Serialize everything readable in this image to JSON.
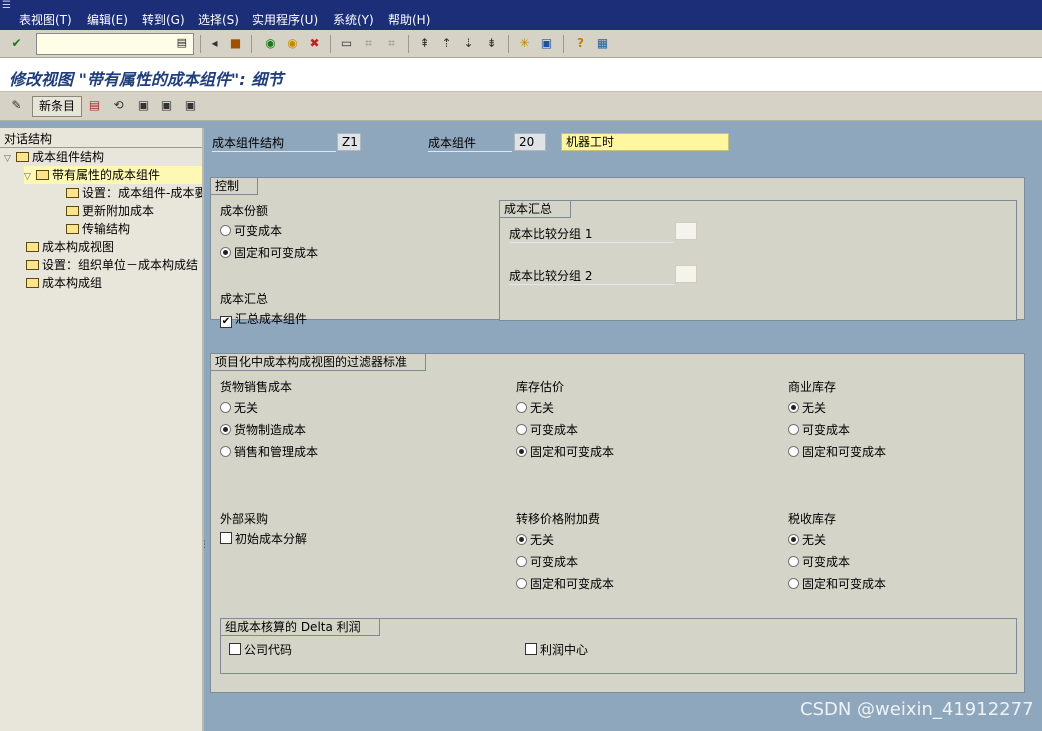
{
  "menu": [
    "表视图(T)",
    "编辑(E)",
    "转到(G)",
    "选择(S)",
    "实用程序(U)",
    "系统(Y)",
    "帮助(H)"
  ],
  "title": "修改视图 \"带有属性的成本组件\": 细节",
  "app_toolbar": {
    "new_entries": "新条目"
  },
  "tree": {
    "header": "对话结构",
    "items": [
      {
        "label": "成本组件结构"
      },
      {
        "label": "带有属性的成本组件"
      },
      {
        "label": "设置：成本组件-成本要"
      },
      {
        "label": "更新附加成本"
      },
      {
        "label": "传输结构"
      },
      {
        "label": "成本构成视图"
      },
      {
        "label": "设置：组织单位－成本构成结"
      },
      {
        "label": "成本构成组"
      }
    ]
  },
  "header_fields": {
    "structure_label": "成本组件结构",
    "structure_value": "Z1",
    "component_label": "成本组件",
    "component_value": "20",
    "component_name": "机器工时"
  },
  "control": {
    "title": "控制",
    "share_label": "成本份额",
    "options": [
      "可变成本",
      "固定和可变成本"
    ],
    "summary_label": "成本汇总",
    "summary_check": "汇总成本组件",
    "sub_title": "成本汇总",
    "compare1": "成本比较分组 1",
    "compare2": "成本比较分组 2"
  },
  "filter": {
    "title": "项目化中成本构成视图的过滤器标准",
    "cogs": {
      "label": "货物销售成本",
      "options": [
        "无关",
        "货物制造成本",
        "销售和管理成本"
      ]
    },
    "inventory": {
      "label": "库存估价",
      "options": [
        "无关",
        "可变成本",
        "固定和可变成本"
      ]
    },
    "commercial": {
      "label": "商业库存",
      "options": [
        "无关",
        "可变成本",
        "固定和可变成本"
      ]
    },
    "external": {
      "label": "外部采购",
      "check": "初始成本分解"
    },
    "transfer": {
      "label": "转移价格附加费",
      "options": [
        "无关",
        "可变成本",
        "固定和可变成本"
      ]
    },
    "tax": {
      "label": "税收库存",
      "options": [
        "无关",
        "可变成本",
        "固定和可变成本"
      ]
    }
  },
  "delta": {
    "title": "组成本核算的 Delta 利润",
    "company_code": "公司代码",
    "profit_center": "利润中心"
  },
  "watermark": "CSDN @weixin_41912277"
}
